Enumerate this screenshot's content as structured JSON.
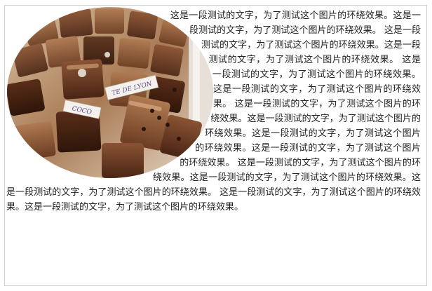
{
  "article": {
    "paragraph": "这是一段测试的文字，为了测试这个图片的环绕效果。这是一段测试的文字，为了测试这个图片的环绕效果。 这是一段测试的文字，为了测试这个图片的环绕效果。这是一段测试的文字，为了测试这个图片的环绕效果。 这是一段测试的文字，为了测试这个图片的环绕效果。这是一段测试的文字，为了测试这个图片的环绕效果。 这是一段测试的文字，为了测试这个图片的环绕效果。这是一段测试的文字，为了测试这个图片的环绕效果。这是一段测试的文字，为了测试这个图片的环绕效果。这是一段测试的文字，为了测试这个图片的环绕效果。 这是一段测试的文字，为了测试这个图片的环绕效果。这是一段测试的文字，为了测试这个图片的环绕效果。这是一段测试的文字，为了测试这个图片的环绕效果。 这是一段测试的文字，为了测试这个图片的环绕效果。这是一段测试的文字，为了测试这个图片的环绕效果。"
  },
  "image": {
    "label_coco": "COCO",
    "label_lyon": "TE DE LYON"
  }
}
